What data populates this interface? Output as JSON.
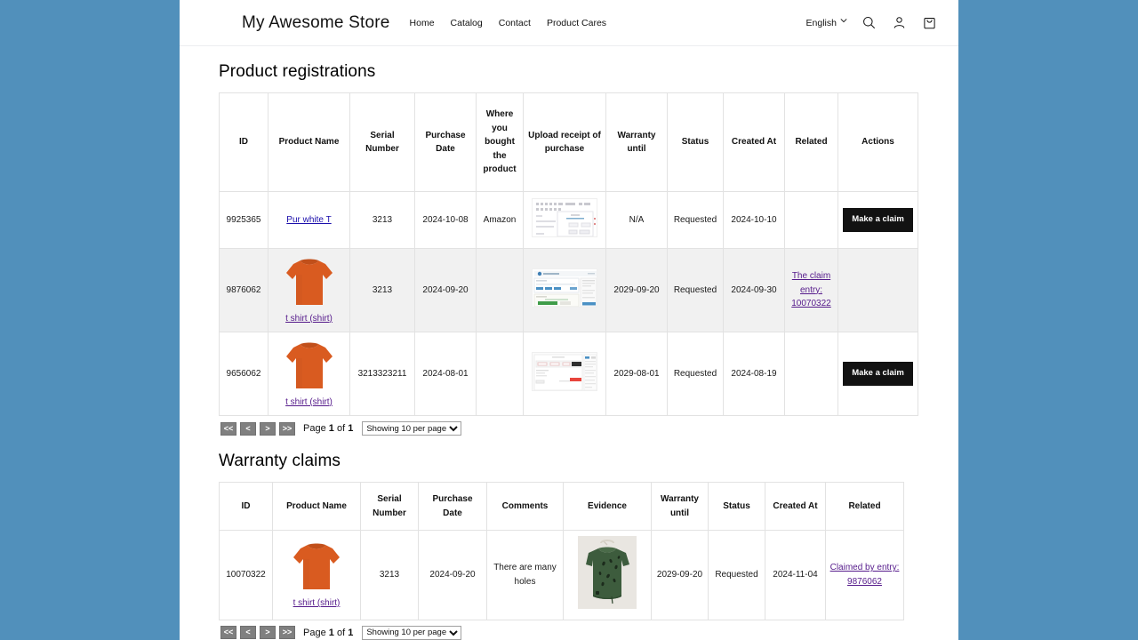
{
  "header": {
    "store_name": "My Awesome Store",
    "nav": [
      {
        "label": "Home"
      },
      {
        "label": "Catalog"
      },
      {
        "label": "Contact"
      },
      {
        "label": "Product Cares"
      }
    ],
    "language": "English",
    "icons": {
      "chevron": "chevron-down-icon",
      "search": "search-icon",
      "account": "account-icon",
      "cart": "cart-icon"
    }
  },
  "registrations": {
    "title": "Product registrations",
    "columns": [
      "ID",
      "Product Name",
      "Serial Number",
      "Purchase Date",
      "Where you bought the product",
      "Upload receipt of purchase",
      "Warranty until",
      "Status",
      "Created At",
      "Related",
      "Actions"
    ],
    "rows": [
      {
        "id": "9925365",
        "product_name": "Pur white T",
        "product_has_image": false,
        "serial_number": "3213",
        "purchase_date": "2024-10-08",
        "where_bought": "Amazon",
        "receipt": "receipt-form-screenshot",
        "warranty_until": "N/A",
        "status": "Requested",
        "created_at": "2024-10-10",
        "related": "",
        "action_label": "Make a claim",
        "has_action": true
      },
      {
        "id": "9876062",
        "product_name": "t shirt (shirt)",
        "product_has_image": true,
        "serial_number": "3213",
        "purchase_date": "2024-09-20",
        "where_bought": "",
        "receipt": "receipt-dashboard-screenshot",
        "warranty_until": "2029-09-20",
        "status": "Requested",
        "created_at": "2024-09-30",
        "related": "The claim entry: 10070322",
        "action_label": "",
        "has_action": false
      },
      {
        "id": "9656062",
        "product_name": "t shirt (shirt)",
        "product_has_image": true,
        "serial_number": "3213323211",
        "purchase_date": "2024-08-01",
        "where_bought": "",
        "receipt": "receipt-table-screenshot",
        "warranty_until": "2029-08-01",
        "status": "Requested",
        "created_at": "2024-08-19",
        "related": "",
        "action_label": "Make a claim",
        "has_action": true
      }
    ],
    "pager": {
      "first": "<<",
      "prev": "<",
      "next": ">",
      "last": ">>",
      "page_prefix": "Page",
      "page_number": "1",
      "page_of": "of",
      "page_total": "1",
      "per_page": "Showing 10 per page"
    }
  },
  "claims": {
    "title": "Warranty claims",
    "columns": [
      "ID",
      "Product Name",
      "Serial Number",
      "Purchase Date",
      "Comments",
      "Evidence",
      "Warranty until",
      "Status",
      "Created At",
      "Related"
    ],
    "rows": [
      {
        "id": "10070322",
        "product_name": "t shirt (shirt)",
        "serial_number": "3213",
        "purchase_date": "2024-09-20",
        "comments": "There are many holes",
        "evidence": "green-damaged-shirt-photo",
        "warranty_until": "2029-09-20",
        "status": "Requested",
        "created_at": "2024-11-04",
        "related": "Claimed by entry: 9876062"
      }
    ],
    "pager": {
      "first": "<<",
      "prev": "<",
      "next": ">",
      "last": ">>",
      "page_prefix": "Page",
      "page_number": "1",
      "page_of": "of",
      "page_total": "1",
      "per_page": "Showing 10 per page"
    }
  },
  "colors": {
    "page_backdrop": "#5190bb",
    "button_dark": "#121212",
    "pager_button": "#808080",
    "link_visited": "#551a8b",
    "link_fresh": "#1a0dab",
    "row_alt": "#f1f1f1",
    "shirt_orange": "#d95b20"
  }
}
